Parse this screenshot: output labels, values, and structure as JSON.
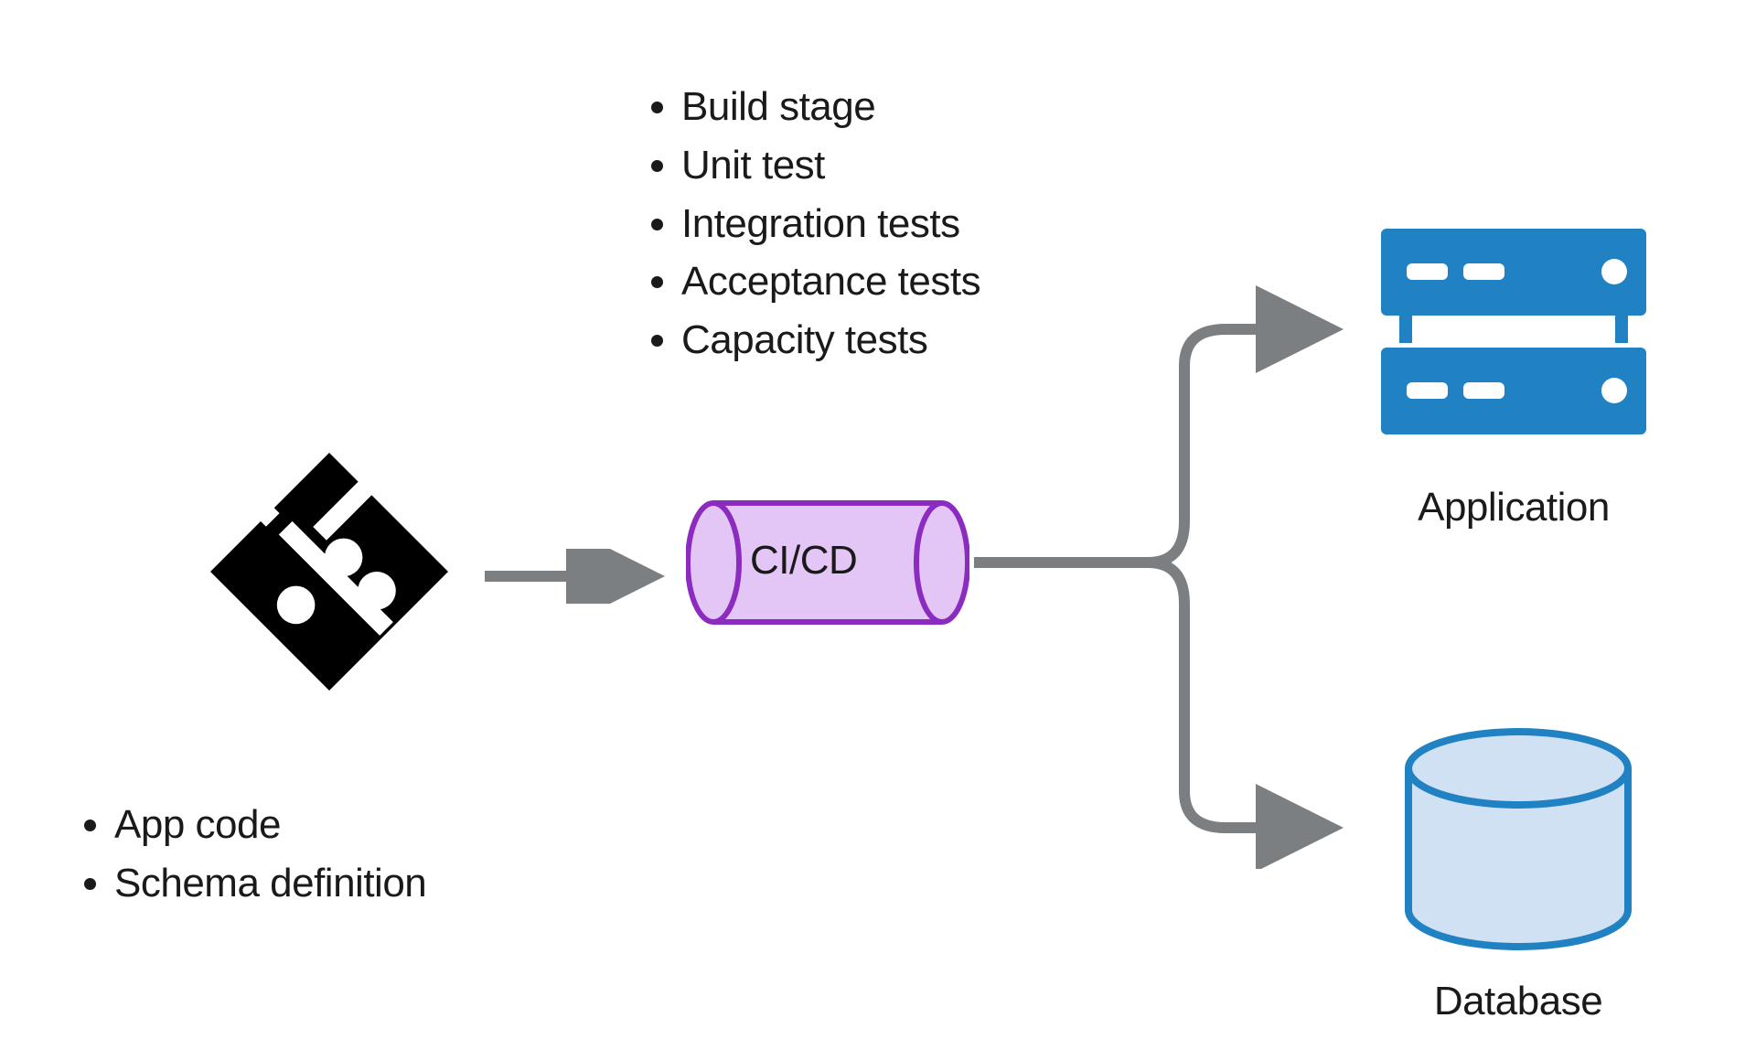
{
  "source": {
    "icon": "git-icon",
    "bullets": [
      "App code",
      "Schema definition"
    ]
  },
  "pipeline": {
    "label": "CI/CD",
    "bullets": [
      "Build stage",
      "Unit test",
      "Integration tests",
      "Acceptance tests",
      "Capacity tests"
    ]
  },
  "targets": {
    "application_label": "Application",
    "database_label": "Database"
  },
  "colors": {
    "arrow": "#7b7f82",
    "pipe_stroke": "#8c2bc0",
    "pipe_fill": "#e3c6f5",
    "server_fill": "#2081c3",
    "db_stroke": "#2081c3",
    "db_fill": "#cfe1f3",
    "git": "#000000",
    "text": "#1a1a1a"
  }
}
